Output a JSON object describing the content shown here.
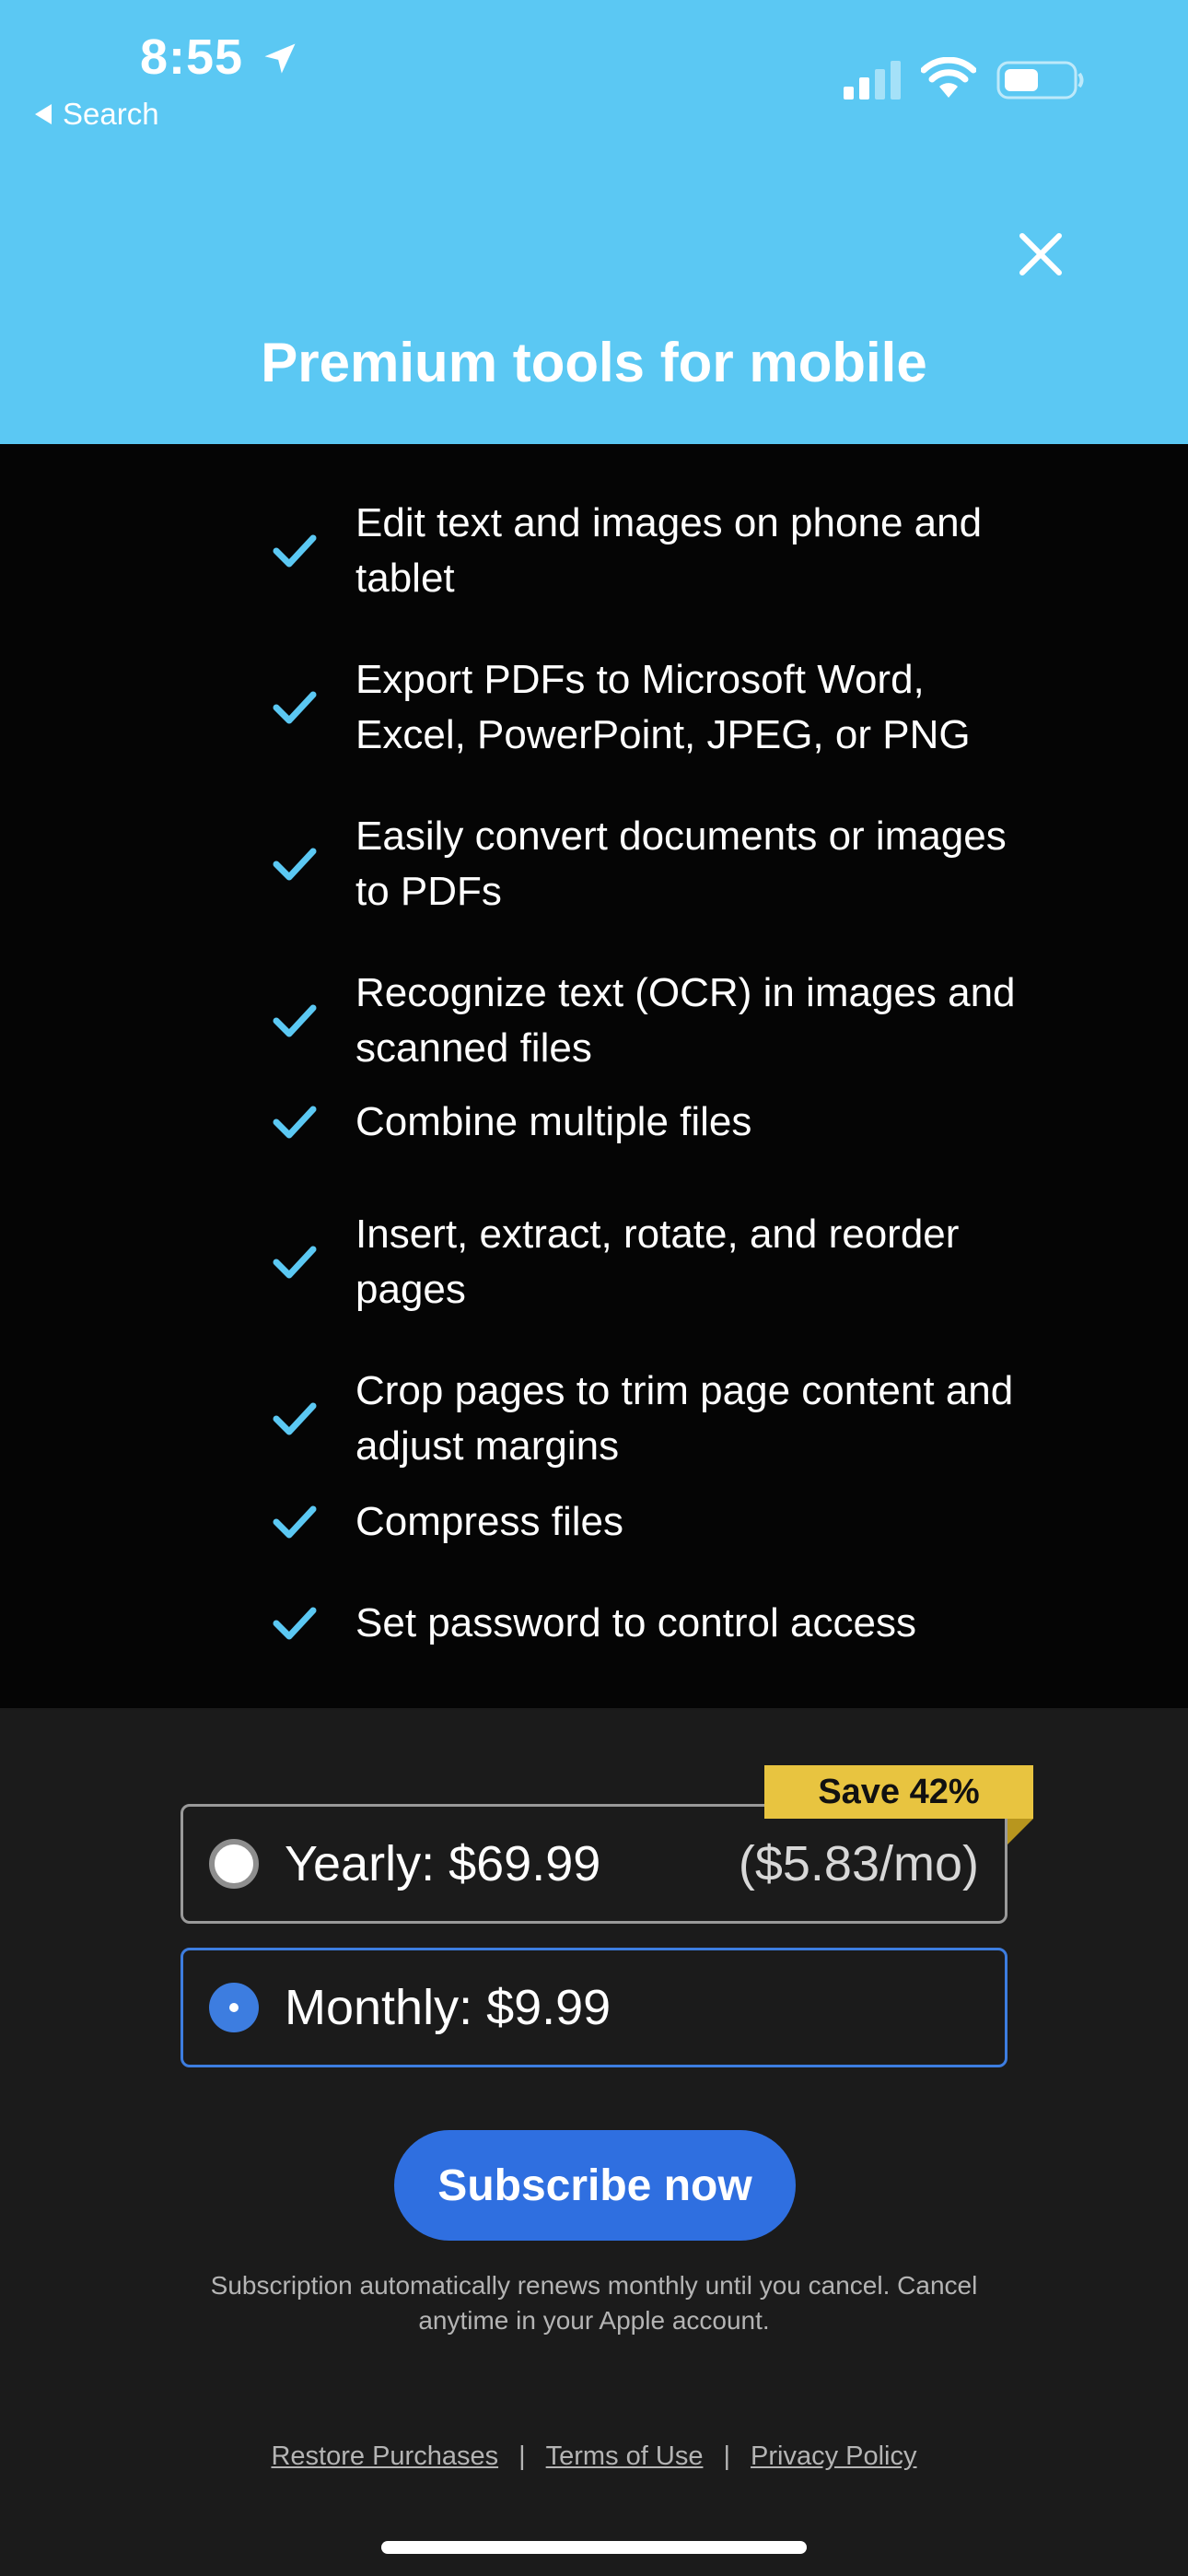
{
  "status_bar": {
    "time": "8:55",
    "back_label": "Search"
  },
  "header": {
    "title": "Premium tools for mobile"
  },
  "features": [
    "Edit text and images on phone and tablet",
    "Export PDFs to Microsoft Word, Excel, PowerPoint, JPEG, or PNG",
    "Easily convert documents or images to PDFs",
    "Recognize text (OCR) in images and scanned files",
    "Combine multiple files",
    "Insert, extract, rotate, and reorder pages",
    "Crop pages to trim page content and adjust margins",
    "Compress files",
    "Set password to control access"
  ],
  "pricing": {
    "badge": "Save 42%",
    "yearly": {
      "label": "Yearly: $69.99",
      "per_month": "($5.83/mo)",
      "selected": false
    },
    "monthly": {
      "label": "Monthly: $9.99",
      "selected": true
    }
  },
  "subscribe_label": "Subscribe now",
  "disclaimer": "Subscription automatically renews monthly until you cancel. Cancel anytime in your Apple account.",
  "footer": {
    "restore": "Restore Purchases",
    "terms": "Terms of Use",
    "privacy": "Privacy Policy",
    "separator": "|"
  },
  "colors": {
    "header_bg": "#5bc8f3",
    "features_bg": "#050505",
    "pricing_bg": "#1b1b1b",
    "check": "#5bc8f3",
    "accent_blue": "#2f6fe0",
    "badge": "#e8c440"
  }
}
